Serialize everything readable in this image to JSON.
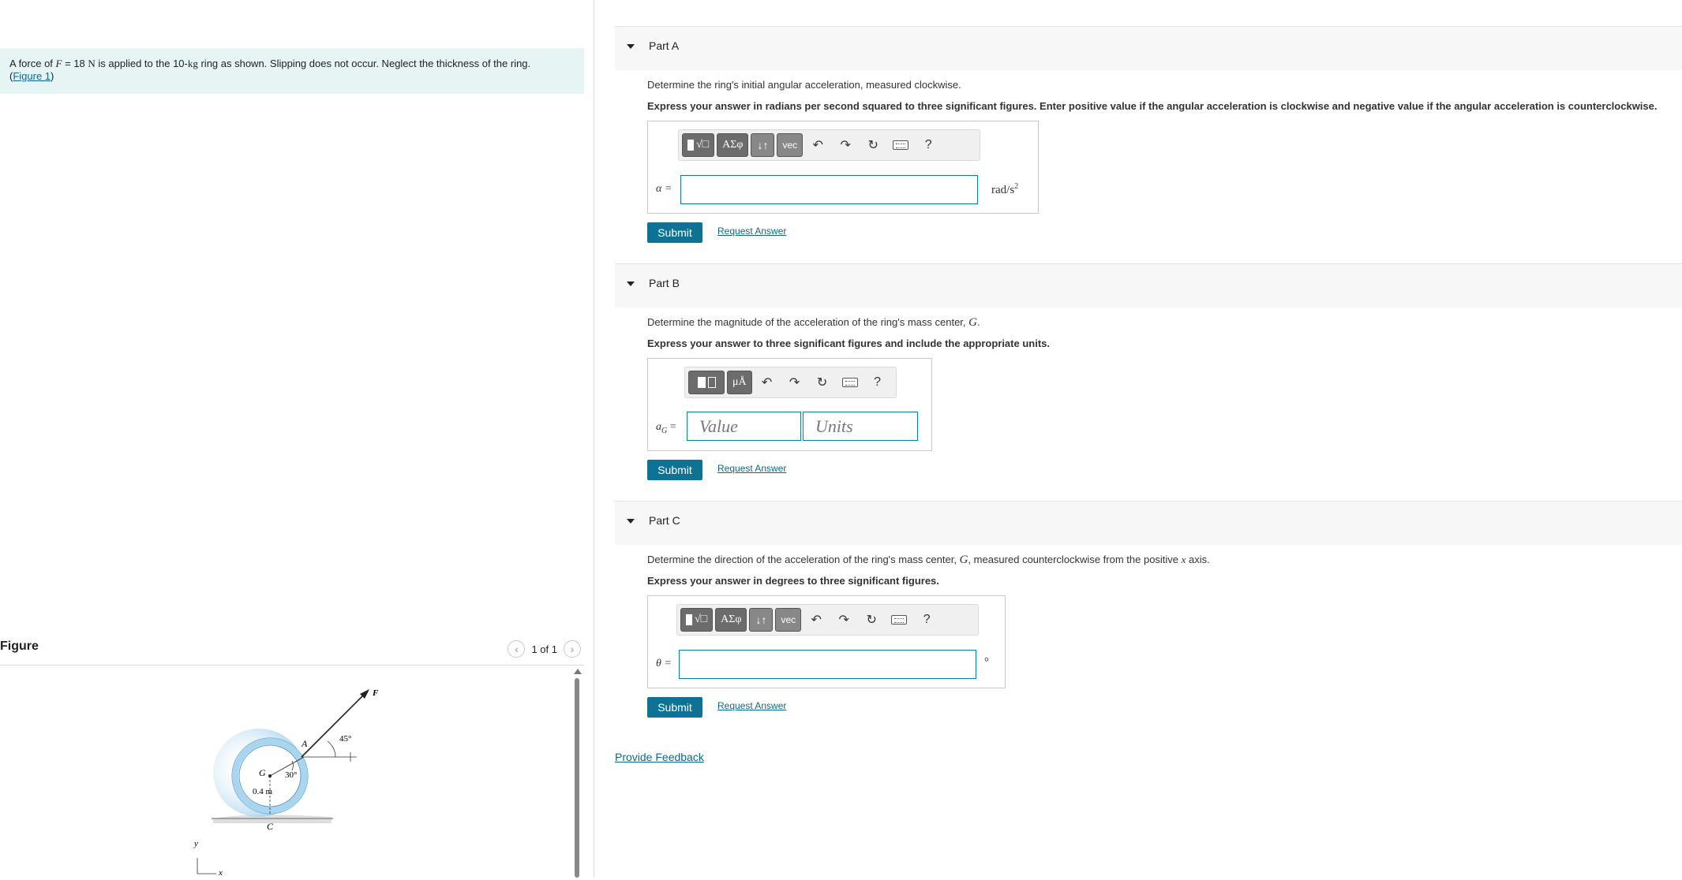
{
  "problem": {
    "text_prefix": "A force of ",
    "force_symbol": "F",
    "force_value": " = 18 ",
    "force_unit": "N",
    "text_mid": " is applied to the 10-",
    "mass_unit": "kg",
    "text_suffix": " ring as shown. Slipping does not occur. Neglect the thickness of the ring.",
    "figure_link_open": "(",
    "figure_link": "Figure 1",
    "figure_link_close": ")"
  },
  "figure": {
    "title": "Figure",
    "pager": "1 of 1",
    "labels": {
      "F": "F",
      "A": "A",
      "angle45": "45°",
      "G": "G",
      "angle30": "30°",
      "radius": "0.4 m",
      "C": "C",
      "y": "y",
      "x": "x"
    }
  },
  "toolbar_icons": {
    "templates": "templates-icon",
    "symbols": "ΑΣφ",
    "sort": "↓↑",
    "vec": "vec",
    "units": "μÅ",
    "help": "?"
  },
  "parts": [
    {
      "label": "Part A",
      "question": "Determine the ring's initial angular acceleration, measured clockwise.",
      "instruction": "Express your answer in radians per second squared to three significant figures. Enter positive value if the angular acceleration is clockwise and negative value if the angular acceleration is counterclockwise.",
      "answer_label": "α =",
      "unit_base": "rad/s",
      "unit_exp": "2",
      "submit": "Submit",
      "request": "Request Answer"
    },
    {
      "label": "Part B",
      "question_prefix": "Determine the magnitude of the acceleration of the ring's mass center, ",
      "question_symbol": "G",
      "question_suffix": ".",
      "instruction": "Express your answer to three significant figures and include the appropriate units.",
      "answer_label_base": "a",
      "answer_label_sub": "G",
      "answer_label_eq": " =",
      "value_placeholder": "Value",
      "units_placeholder": "Units",
      "submit": "Submit",
      "request": "Request Answer"
    },
    {
      "label": "Part C",
      "question_prefix": "Determine the direction of the acceleration of the ring's mass center, ",
      "question_symbol": "G",
      "question_mid": ", measured counterclockwise from the positive ",
      "question_axis": "x",
      "question_suffix": " axis.",
      "instruction": "Express your answer in degrees to three significant figures.",
      "answer_label": "θ =",
      "unit": "°",
      "submit": "Submit",
      "request": "Request Answer"
    }
  ],
  "feedback": "Provide Feedback",
  "colors": {
    "accent": "#0e7295",
    "link": "#0b6a8a",
    "problem_bg": "#e6f4f3",
    "ring": "#9fd0ec"
  }
}
